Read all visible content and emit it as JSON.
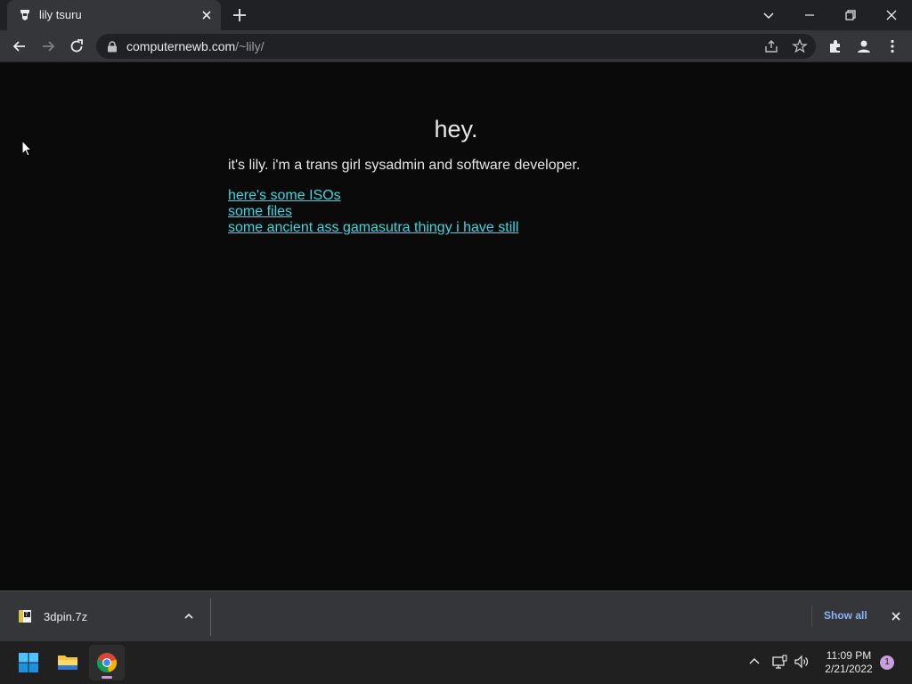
{
  "browser": {
    "tab_title": "lily tsuru",
    "url_host": "computernewb.com",
    "url_path": "/~lily/"
  },
  "page": {
    "heading": "hey.",
    "intro": "it's lily. i'm a trans girl sysadmin and software developer.",
    "links": [
      "here's some ISOs",
      "some files",
      "some ancient ass gamasutra thingy i have still"
    ],
    "link_color": "#36d7e0"
  },
  "downloads": {
    "file_name": "3dpin.7z",
    "show_all_label": "Show all"
  },
  "taskbar": {
    "time": "11:09 PM",
    "date": "2/21/2022",
    "notification_count": "1"
  }
}
